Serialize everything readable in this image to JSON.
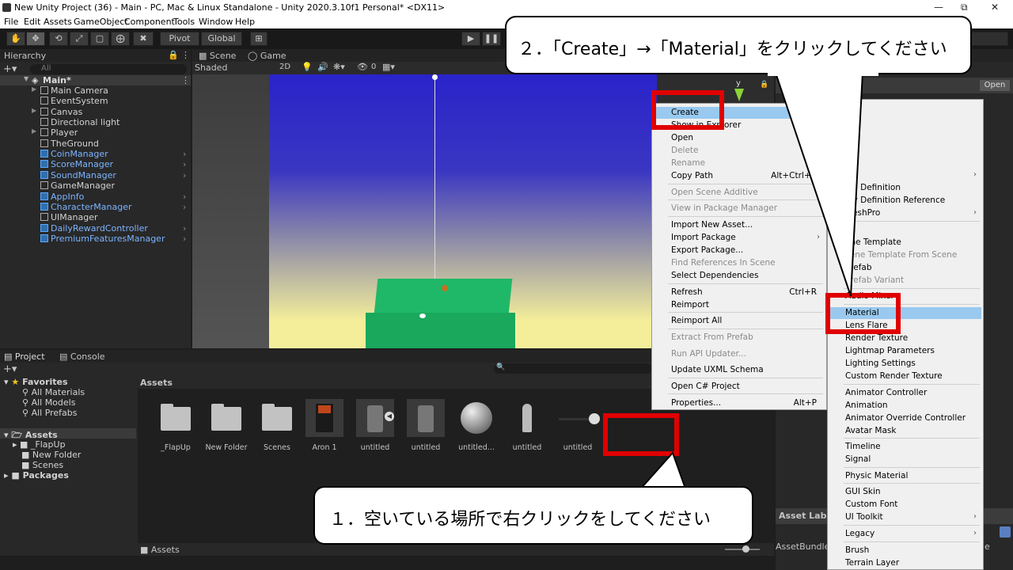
{
  "window": {
    "title": "New Unity Project (36) - Main - PC, Mac & Linux Standalone - Unity 2020.3.10f1 Personal* <DX11>"
  },
  "menubar": [
    "File",
    "Edit",
    "Assets",
    "GameObject",
    "Component",
    "Tools",
    "Window",
    "Help"
  ],
  "toolbar": {
    "pivot": "Pivot",
    "global": "Global"
  },
  "hierarchy": {
    "tab": "Hierarchy",
    "search_placeholder": "All",
    "scene": "Main*",
    "items": [
      {
        "label": "Main Camera",
        "blue": false,
        "arrow": true,
        "chev": false
      },
      {
        "label": "EventSystem",
        "blue": false,
        "arrow": false,
        "chev": false
      },
      {
        "label": "Canvas",
        "blue": false,
        "arrow": true,
        "chev": false
      },
      {
        "label": "Directional light",
        "blue": false,
        "arrow": false,
        "chev": false
      },
      {
        "label": "Player",
        "blue": false,
        "arrow": true,
        "chev": false
      },
      {
        "label": "TheGround",
        "blue": false,
        "arrow": false,
        "chev": false
      },
      {
        "label": "CoinManager",
        "blue": true,
        "arrow": false,
        "chev": true
      },
      {
        "label": "ScoreManager",
        "blue": true,
        "arrow": false,
        "chev": true
      },
      {
        "label": "SoundManager",
        "blue": true,
        "arrow": false,
        "chev": true
      },
      {
        "label": "GameManager",
        "blue": false,
        "arrow": false,
        "chev": false
      },
      {
        "label": "AppInfo",
        "blue": true,
        "arrow": false,
        "chev": true
      },
      {
        "label": "CharacterManager",
        "blue": true,
        "arrow": false,
        "chev": true
      },
      {
        "label": "UIManager",
        "blue": false,
        "arrow": false,
        "chev": false
      },
      {
        "label": "DailyRewardController",
        "blue": true,
        "arrow": false,
        "chev": true
      },
      {
        "label": "PremiumFeaturesManager",
        "blue": true,
        "arrow": false,
        "chev": true
      }
    ]
  },
  "scene_view": {
    "tab_scene": "Scene",
    "tab_game": "Game",
    "shading": "Shaded",
    "mode_2d": "2D",
    "gizmo_axis": "y",
    "gizmo_count": "0"
  },
  "inspector": {
    "open_button": "Open",
    "asset_labels": "Asset Label",
    "asset_bundle": "AssetBundle",
    "variant_fragment": "e"
  },
  "project": {
    "tab_project": "Project",
    "tab_console": "Console",
    "favorites": "Favorites",
    "fav_items": [
      "All Materials",
      "All Models",
      "All Prefabs"
    ],
    "assets_root": "Assets",
    "asset_folders": [
      "_FlapUp",
      "New Folder",
      "Scenes"
    ],
    "packages": "Packages",
    "breadcrumb": "Assets",
    "footer_path": "Assets",
    "grid": [
      {
        "label": "_FlapUp",
        "kind": "folder"
      },
      {
        "label": "New Folder",
        "kind": "folder"
      },
      {
        "label": "Scenes",
        "kind": "folder"
      },
      {
        "label": "Aron 1",
        "kind": "model"
      },
      {
        "label": "untitled",
        "kind": "model"
      },
      {
        "label": "untitled",
        "kind": "model"
      },
      {
        "label": "untitled...",
        "kind": "sphere"
      },
      {
        "label": "untitled",
        "kind": "figure"
      },
      {
        "label": "untitled",
        "kind": "slider"
      }
    ]
  },
  "context_menu": {
    "items": [
      {
        "label": "Create",
        "shortcut": "",
        "disabled": false,
        "sub": false,
        "highlight": true
      },
      {
        "label": "Show in Explorer",
        "shortcut": "",
        "disabled": false,
        "sub": false
      },
      {
        "label": "Open",
        "shortcut": "",
        "disabled": false,
        "sub": false
      },
      {
        "label": "Delete",
        "shortcut": "",
        "disabled": true,
        "sub": false
      },
      {
        "label": "Rename",
        "shortcut": "",
        "disabled": true,
        "sub": false
      },
      {
        "label": "Copy Path",
        "shortcut": "Alt+Ctrl+C",
        "disabled": false,
        "sub": false
      },
      {
        "label": "Open Scene Additive",
        "shortcut": "",
        "disabled": true,
        "sub": false
      },
      {
        "label": "View in Package Manager",
        "shortcut": "",
        "disabled": true,
        "sub": false
      },
      {
        "label": "Import New Asset...",
        "shortcut": "",
        "disabled": false,
        "sub": false
      },
      {
        "label": "Import Package",
        "shortcut": "",
        "disabled": false,
        "sub": true
      },
      {
        "label": "Export Package...",
        "shortcut": "",
        "disabled": false,
        "sub": false
      },
      {
        "label": "Find References In Scene",
        "shortcut": "",
        "disabled": true,
        "sub": false
      },
      {
        "label": "Select Dependencies",
        "shortcut": "",
        "disabled": false,
        "sub": false
      },
      {
        "label": "Refresh",
        "shortcut": "Ctrl+R",
        "disabled": false,
        "sub": false
      },
      {
        "label": "Reimport",
        "shortcut": "",
        "disabled": false,
        "sub": false
      },
      {
        "label": "Reimport All",
        "shortcut": "",
        "disabled": false,
        "sub": false
      },
      {
        "label": "Extract From Prefab",
        "shortcut": "",
        "disabled": true,
        "sub": false
      },
      {
        "label": "Run API Updater...",
        "shortcut": "",
        "disabled": true,
        "sub": false
      },
      {
        "label": "Update UXML Schema",
        "shortcut": "",
        "disabled": false,
        "sub": false
      },
      {
        "label": "Open C# Project",
        "shortcut": "",
        "disabled": false,
        "sub": false
      },
      {
        "label": "Properties...",
        "shortcut": "Alt+P",
        "disabled": false,
        "sub": false
      }
    ]
  },
  "submenu": {
    "items": [
      {
        "label": "ies",
        "disabled": false,
        "sub": true
      },
      {
        "label": "bly Definition",
        "disabled": false
      },
      {
        "label": "bly Definition Reference",
        "disabled": false
      },
      {
        "label": "MeshPro",
        "disabled": false,
        "sub": true
      },
      {
        "label": "ne",
        "disabled": false
      },
      {
        "label": "ene Template",
        "disabled": false
      },
      {
        "label": "cene Template From Scene",
        "disabled": true
      },
      {
        "label": "Prefab",
        "disabled": false
      },
      {
        "label": "Prefab Variant",
        "disabled": true
      },
      {
        "label": "Audio Mixer",
        "disabled": false
      },
      {
        "label": "Material",
        "disabled": false,
        "highlight": true
      },
      {
        "label": "Lens Flare",
        "disabled": false
      },
      {
        "label": "Render Texture",
        "disabled": false
      },
      {
        "label": "Lightmap Parameters",
        "disabled": false
      },
      {
        "label": "Lighting Settings",
        "disabled": false
      },
      {
        "label": "Custom Render Texture",
        "disabled": false
      },
      {
        "label": "Animator Controller",
        "disabled": false
      },
      {
        "label": "Animation",
        "disabled": false
      },
      {
        "label": "Animator Override Controller",
        "disabled": false
      },
      {
        "label": "Avatar Mask",
        "disabled": false
      },
      {
        "label": "Timeline",
        "disabled": false
      },
      {
        "label": "Signal",
        "disabled": false
      },
      {
        "label": "Physic Material",
        "disabled": false
      },
      {
        "label": "GUI Skin",
        "disabled": false
      },
      {
        "label": "Custom Font",
        "disabled": false
      },
      {
        "label": "UI Toolkit",
        "disabled": false,
        "sub": true
      },
      {
        "label": "Legacy",
        "disabled": false,
        "sub": true
      },
      {
        "label": "Brush",
        "disabled": false
      },
      {
        "label": "Terrain Layer",
        "disabled": false
      }
    ]
  },
  "annotations": {
    "step1": "１．空いている場所で右クリックをしてください",
    "step2": "２．「Create」→「Material」をクリックしてください"
  },
  "colors": {
    "highlight": "#99c9ef",
    "red_box": "#e00000",
    "ground": "#19a85c",
    "sky_top": "#2a23c9",
    "sky_bottom": "#f4ee9a"
  }
}
